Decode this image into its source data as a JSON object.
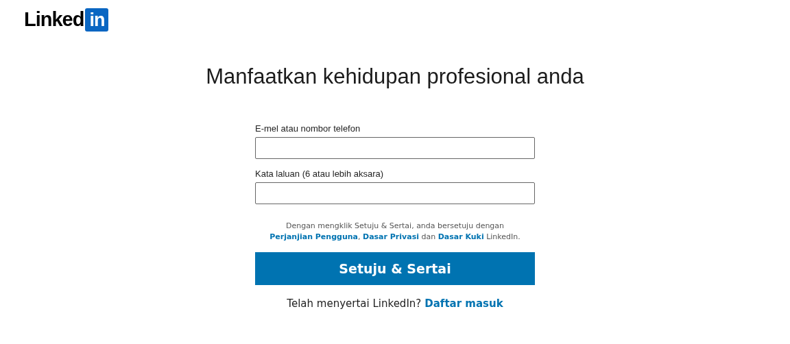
{
  "logo": {
    "word": "Linked",
    "badge": "in"
  },
  "heading": "Manfaatkan kehidupan profesional anda",
  "fields": [
    {
      "label": "E-mel atau nombor telefon"
    },
    {
      "label": "Kata laluan (6 atau lebih aksara)"
    }
  ],
  "agreement": [
    {
      "kind": "text",
      "text": "Dengan mengklik Setuju & Sertai, anda bersetuju dengan "
    },
    {
      "kind": "link",
      "text": "Perjanjian Pengguna"
    },
    {
      "kind": "text",
      "text": ", "
    },
    {
      "kind": "link",
      "text": "Dasar Privasi"
    },
    {
      "kind": "text",
      "text": " dan "
    },
    {
      "kind": "link",
      "text": "Dasar Kuki"
    },
    {
      "kind": "text",
      "text": " LinkedIn."
    }
  ],
  "submit_button": "Setuju & Sertai",
  "signin": {
    "prompt": "Telah menyertai LinkedIn?",
    "link": "Daftar masuk"
  }
}
